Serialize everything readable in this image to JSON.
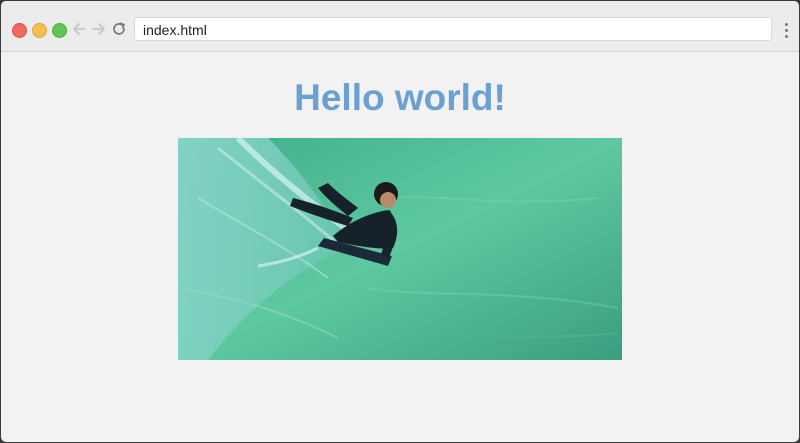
{
  "browser": {
    "address": "index.html",
    "icons": {
      "back": "arrow-left-icon",
      "forward": "arrow-right-icon",
      "reload": "reload-icon",
      "menu": "kebab-menu-icon"
    }
  },
  "page": {
    "heading": "Hello world!",
    "heading_color": "#6aa0d3",
    "image_alt": "Bodyboarder riding a green wave"
  }
}
